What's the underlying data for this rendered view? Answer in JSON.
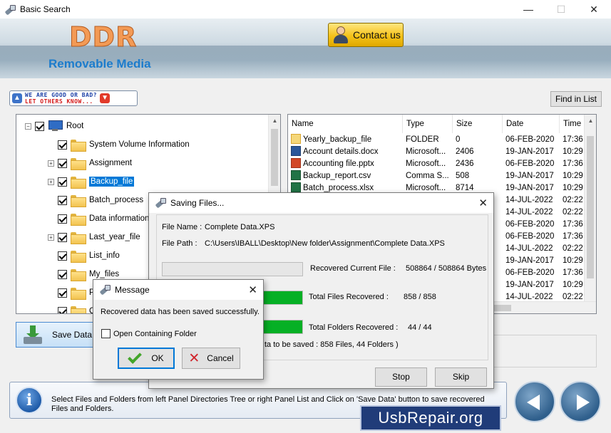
{
  "window": {
    "title": "Basic Search",
    "minimize": "—",
    "maximize": "☐",
    "close": "✕"
  },
  "header": {
    "logo": "DDR",
    "subtitle": "Removable Media",
    "contact_label": "Contact us"
  },
  "feedback": {
    "line1": "WE ARE GOOD OR BAD?",
    "line2": "LET OTHERS KNOW..."
  },
  "toolbar": {
    "find_label": "Find in List",
    "save_label": "Save Data"
  },
  "tree": {
    "root": "Root",
    "items": [
      {
        "label": "System Volume Information",
        "expandable": false
      },
      {
        "label": "Assignment",
        "expandable": true
      },
      {
        "label": "Backup_file",
        "expandable": true,
        "selected": true
      },
      {
        "label": "Batch_process",
        "expandable": false
      },
      {
        "label": "Data information",
        "expandable": false
      },
      {
        "label": "Last_year_file",
        "expandable": true
      },
      {
        "label": "List_info",
        "expandable": false
      },
      {
        "label": "My_files",
        "expandable": false
      },
      {
        "label": "Pi",
        "expandable": false
      },
      {
        "label": "O",
        "expandable": false
      }
    ]
  },
  "list": {
    "columns": [
      "Name",
      "Type",
      "Size",
      "Date",
      "Time"
    ],
    "rows": [
      {
        "icon": "folder-icon",
        "name": "Yearly_backup_file",
        "type": "FOLDER",
        "size": "0",
        "date": "06-FEB-2020",
        "time": "17:36"
      },
      {
        "icon": "word-icon",
        "name": "Account details.docx",
        "type": "Microsoft...",
        "size": "2406",
        "date": "19-JAN-2017",
        "time": "10:29"
      },
      {
        "icon": "ppt-icon",
        "name": "Accounting file.pptx",
        "type": "Microsoft...",
        "size": "2436",
        "date": "06-FEB-2020",
        "time": "17:36"
      },
      {
        "icon": "xls-icon",
        "name": "Backup_report.csv",
        "type": "Comma S...",
        "size": "508",
        "date": "19-JAN-2017",
        "time": "10:29"
      },
      {
        "icon": "xls-icon",
        "name": "Batch_process.xlsx",
        "type": "Microsoft...",
        "size": "8714",
        "date": "19-JAN-2017",
        "time": "10:29"
      },
      {
        "date": "14-JUL-2022",
        "time": "02:22"
      },
      {
        "date": "14-JUL-2022",
        "time": "02:22"
      },
      {
        "date": "06-FEB-2020",
        "time": "17:36"
      },
      {
        "date": "06-FEB-2020",
        "time": "17:36"
      },
      {
        "date": "14-JUL-2022",
        "time": "02:22"
      },
      {
        "date": "19-JAN-2017",
        "time": "10:29"
      },
      {
        "date": "06-FEB-2020",
        "time": "17:36"
      },
      {
        "date": "19-JAN-2017",
        "time": "10:29"
      },
      {
        "date": "14-JUL-2022",
        "time": "02:22"
      }
    ]
  },
  "saving": {
    "title": "Saving Files...",
    "file_name_label": "File Name :",
    "file_name": "Complete Data.XPS",
    "file_path_label": "File Path :",
    "file_path": "C:\\Users\\IBALL\\Desktop\\New folder\\Assignment\\Complete Data.XPS",
    "current_label": "Recovered Current File :",
    "current_value": "508864 / 508864 Bytes",
    "files_label": "Total Files Recovered :",
    "files_value": "858 / 858",
    "folders_label": "Total Folders Recovered :",
    "folders_value": "44 / 44",
    "summary_partial": "ta to be saved : 858 Files, 44 Folders )",
    "stop_label": "Stop",
    "skip_label": "Skip",
    "progress": {
      "current": 0,
      "files": 1.0,
      "folders": 1.0
    }
  },
  "message": {
    "title": "Message",
    "text": "Recovered data has been saved successfully.",
    "checkbox_label": "Open Containing Folder",
    "checkbox_checked": false,
    "ok_label": "OK",
    "cancel_label": "Cancel"
  },
  "info": {
    "text": "Select Files and Folders from left Panel Directories Tree or right Panel List and Click on 'Save Data' button to save recovered Files and Folders."
  },
  "watermark": "UsbRepair.org"
}
